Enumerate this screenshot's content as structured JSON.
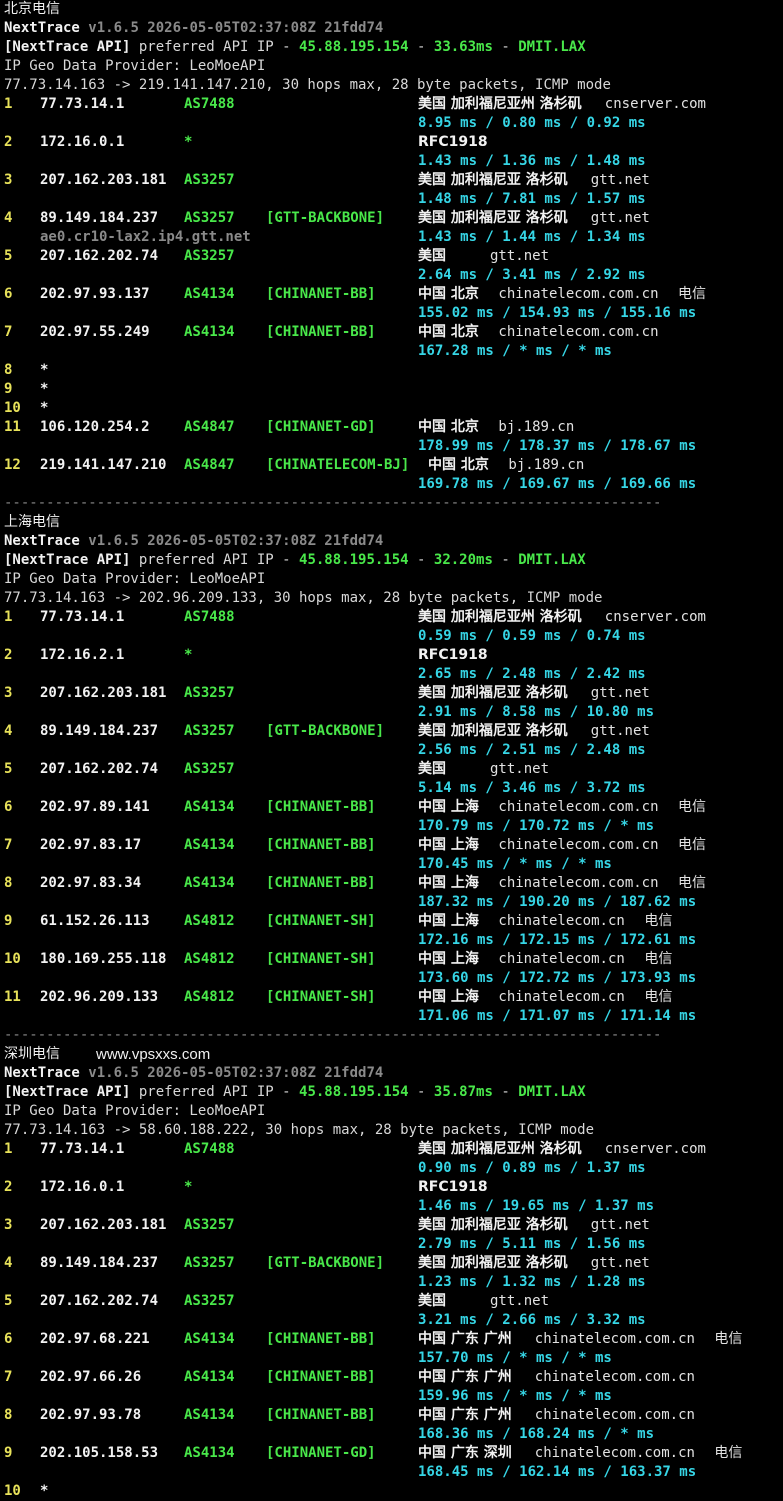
{
  "sections": [
    {
      "title": "北京电信",
      "header": {
        "app": "NextTrace",
        "version": "v1.6.5 2026-05-05T02:37:08Z 21fdd74",
        "api_label": "[NextTrace API]",
        "api_text": " preferred API IP - ",
        "api_ip": "45.88.195.154",
        "api_dash1": " - ",
        "api_latency": "33.63ms",
        "api_dash2": " - ",
        "api_node": "DMIT.LAX",
        "provider": "IP Geo Data Provider: LeoMoeAPI",
        "trace": "77.73.14.163 -> 219.141.147.210, 30 hops max, 28 byte packets, ICMP mode"
      },
      "hops": [
        {
          "n": "1",
          "ip": "77.73.14.1",
          "asn": "AS7488",
          "tag": "",
          "geo": "美国 加利福尼亚州 洛杉矶",
          "host": "cnserver.com",
          "isp": "",
          "rtt": "8.95 ms / 0.80 ms / 0.92 ms"
        },
        {
          "n": "2",
          "ip": "172.16.0.1",
          "asn": "*",
          "tag": "",
          "geo": "RFC1918",
          "host": "",
          "isp": "",
          "rtt": "1.43 ms / 1.36 ms / 1.48 ms"
        },
        {
          "n": "3",
          "ip": "207.162.203.181",
          "asn": "AS3257",
          "tag": "",
          "geo": "美国 加利福尼亚 洛杉矶",
          "host": "gtt.net",
          "isp": "",
          "rtt": "1.48 ms / 7.81 ms / 1.57 ms"
        },
        {
          "n": "4",
          "ip": "89.149.184.237",
          "asn": "AS3257",
          "tag": "[GTT-BACKBONE]",
          "geo": "美国 加利福尼亚 洛杉矶",
          "host": "gtt.net",
          "isp": "",
          "rtt": "1.43 ms / 1.44 ms / 1.34 ms",
          "ptr": "ae0.cr10-lax2.ip4.gtt.net"
        },
        {
          "n": "5",
          "ip": "207.162.202.74",
          "asn": "AS3257",
          "tag": "",
          "geo": "美国",
          "host": "gtt.net",
          "isp": "",
          "rtt": "2.64 ms / 3.41 ms / 2.92 ms"
        },
        {
          "n": "6",
          "ip": "202.97.93.137",
          "asn": "AS4134",
          "tag": "[CHINANET-BB]",
          "geo": "中国 北京",
          "host": "chinatelecom.com.cn",
          "isp": "电信",
          "rtt": "155.02 ms / 154.93 ms / 155.16 ms"
        },
        {
          "n": "7",
          "ip": "202.97.55.249",
          "asn": "AS4134",
          "tag": "[CHINANET-BB]",
          "geo": "中国 北京",
          "host": "chinatelecom.com.cn",
          "isp": "",
          "rtt": "167.28 ms / * ms / * ms"
        },
        {
          "n": "8",
          "ip": "*",
          "star": true
        },
        {
          "n": "9",
          "ip": "*",
          "star": true
        },
        {
          "n": "10",
          "ip": "*",
          "star": true
        },
        {
          "n": "11",
          "ip": "106.120.254.2",
          "asn": "AS4847",
          "tag": "[CHINANET-GD]",
          "geo": "中国 北京",
          "host": "bj.189.cn",
          "isp": "",
          "rtt": "178.99 ms / 178.37 ms / 178.67 ms"
        },
        {
          "n": "12",
          "ip": "219.141.147.210",
          "asn": "AS4847",
          "tag": "[CHINATELECOM-BJ]",
          "geo": "中国 北京",
          "host": "bj.189.cn",
          "isp": "",
          "rtt": "169.78 ms / 169.67 ms / 169.66 ms",
          "geoShift": true
        }
      ]
    },
    {
      "title": "上海电信",
      "header": {
        "app": "NextTrace",
        "version": "v1.6.5 2026-05-05T02:37:08Z 21fdd74",
        "api_label": "[NextTrace API]",
        "api_text": " preferred API IP - ",
        "api_ip": "45.88.195.154",
        "api_dash1": " - ",
        "api_latency": "32.20ms",
        "api_dash2": " - ",
        "api_node": "DMIT.LAX",
        "provider": "IP Geo Data Provider: LeoMoeAPI",
        "trace": "77.73.14.163 -> 202.96.209.133, 30 hops max, 28 byte packets, ICMP mode"
      },
      "hops": [
        {
          "n": "1",
          "ip": "77.73.14.1",
          "asn": "AS7488",
          "tag": "",
          "geo": "美国 加利福尼亚州 洛杉矶",
          "host": "cnserver.com",
          "isp": "",
          "rtt": "0.59 ms / 0.59 ms / 0.74 ms"
        },
        {
          "n": "2",
          "ip": "172.16.2.1",
          "asn": "*",
          "tag": "",
          "geo": "RFC1918",
          "host": "",
          "isp": "",
          "rtt": "2.65 ms / 2.48 ms / 2.42 ms"
        },
        {
          "n": "3",
          "ip": "207.162.203.181",
          "asn": "AS3257",
          "tag": "",
          "geo": "美国 加利福尼亚 洛杉矶",
          "host": "gtt.net",
          "isp": "",
          "rtt": "2.91 ms / 8.58 ms / 10.80 ms"
        },
        {
          "n": "4",
          "ip": "89.149.184.237",
          "asn": "AS3257",
          "tag": "[GTT-BACKBONE]",
          "geo": "美国 加利福尼亚 洛杉矶",
          "host": "gtt.net",
          "isp": "",
          "rtt": "2.56 ms / 2.51 ms / 2.48 ms"
        },
        {
          "n": "5",
          "ip": "207.162.202.74",
          "asn": "AS3257",
          "tag": "",
          "geo": "美国",
          "host": "gtt.net",
          "isp": "",
          "rtt": "5.14 ms / 3.46 ms / 3.72 ms"
        },
        {
          "n": "6",
          "ip": "202.97.89.141",
          "asn": "AS4134",
          "tag": "[CHINANET-BB]",
          "geo": "中国 上海",
          "host": "chinatelecom.com.cn",
          "isp": "电信",
          "rtt": "170.79 ms / 170.72 ms / * ms"
        },
        {
          "n": "7",
          "ip": "202.97.83.17",
          "asn": "AS4134",
          "tag": "[CHINANET-BB]",
          "geo": "中国 上海",
          "host": "chinatelecom.com.cn",
          "isp": "电信",
          "rtt": "170.45 ms / * ms / * ms"
        },
        {
          "n": "8",
          "ip": "202.97.83.34",
          "asn": "AS4134",
          "tag": "[CHINANET-BB]",
          "geo": "中国 上海",
          "host": "chinatelecom.com.cn",
          "isp": "电信",
          "rtt": "187.32 ms / 190.20 ms / 187.62 ms"
        },
        {
          "n": "9",
          "ip": "61.152.26.113",
          "asn": "AS4812",
          "tag": "[CHINANET-SH]",
          "geo": "中国 上海",
          "host": "chinatelecom.cn",
          "isp": "电信",
          "rtt": "172.16 ms / 172.15 ms / 172.61 ms"
        },
        {
          "n": "10",
          "ip": "180.169.255.118",
          "asn": "AS4812",
          "tag": "[CHINANET-SH]",
          "geo": "中国 上海",
          "host": "chinatelecom.cn",
          "isp": "电信",
          "rtt": "173.60 ms / 172.72 ms / 173.93 ms"
        },
        {
          "n": "11",
          "ip": "202.96.209.133",
          "asn": "AS4812",
          "tag": "[CHINANET-SH]",
          "geo": "中国 上海",
          "host": "chinatelecom.cn",
          "isp": "电信",
          "rtt": "171.06 ms / 171.07 ms / 171.14 ms"
        }
      ]
    },
    {
      "title": "深圳电信",
      "watermark": "www.vpsxxs.com",
      "header": {
        "app": "NextTrace",
        "version": "v1.6.5 2026-05-05T02:37:08Z 21fdd74",
        "api_label": "[NextTrace API]",
        "api_text": " preferred API IP - ",
        "api_ip": "45.88.195.154",
        "api_dash1": " - ",
        "api_latency": "35.87ms",
        "api_dash2": " - ",
        "api_node": "DMIT.LAX",
        "provider": "IP Geo Data Provider: LeoMoeAPI",
        "trace": "77.73.14.163 -> 58.60.188.222, 30 hops max, 28 byte packets, ICMP mode"
      },
      "hops": [
        {
          "n": "1",
          "ip": "77.73.14.1",
          "asn": "AS7488",
          "tag": "",
          "geo": "美国 加利福尼亚州 洛杉矶",
          "host": "cnserver.com",
          "isp": "",
          "rtt": "0.90 ms / 0.89 ms / 1.37 ms"
        },
        {
          "n": "2",
          "ip": "172.16.0.1",
          "asn": "*",
          "tag": "",
          "geo": "RFC1918",
          "host": "",
          "isp": "",
          "rtt": "1.46 ms / 19.65 ms / 1.37 ms"
        },
        {
          "n": "3",
          "ip": "207.162.203.181",
          "asn": "AS3257",
          "tag": "",
          "geo": "美国 加利福尼亚 洛杉矶",
          "host": "gtt.net",
          "isp": "",
          "rtt": "2.79 ms / 5.11 ms / 1.56 ms"
        },
        {
          "n": "4",
          "ip": "89.149.184.237",
          "asn": "AS3257",
          "tag": "[GTT-BACKBONE]",
          "geo": "美国 加利福尼亚 洛杉矶",
          "host": "gtt.net",
          "isp": "",
          "rtt": "1.23 ms / 1.32 ms / 1.28 ms"
        },
        {
          "n": "5",
          "ip": "207.162.202.74",
          "asn": "AS3257",
          "tag": "",
          "geo": "美国",
          "host": "gtt.net",
          "isp": "",
          "rtt": "3.21 ms / 2.66 ms / 3.32 ms"
        },
        {
          "n": "6",
          "ip": "202.97.68.221",
          "asn": "AS4134",
          "tag": "[CHINANET-BB]",
          "geo": "中国 广东 广州",
          "host": "chinatelecom.com.cn",
          "isp": "电信",
          "rtt": "157.70 ms / * ms / * ms"
        },
        {
          "n": "7",
          "ip": "202.97.66.26",
          "asn": "AS4134",
          "tag": "[CHINANET-BB]",
          "geo": "中国 广东 广州",
          "host": "chinatelecom.com.cn",
          "isp": "",
          "rtt": "159.96 ms / * ms / * ms"
        },
        {
          "n": "8",
          "ip": "202.97.93.78",
          "asn": "AS4134",
          "tag": "[CHINANET-BB]",
          "geo": "中国 广东 广州",
          "host": "chinatelecom.com.cn",
          "isp": "",
          "rtt": "168.36 ms / 168.24 ms / * ms"
        },
        {
          "n": "9",
          "ip": "202.105.158.53",
          "asn": "AS4134",
          "tag": "[CHINANET-GD]",
          "geo": "中国 广东 深圳",
          "host": "chinatelecom.com.cn",
          "isp": "电信",
          "rtt": "168.45 ms / 162.14 ms / 163.37 ms"
        },
        {
          "n": "10",
          "ip": "*",
          "star": true
        }
      ]
    }
  ],
  "separator": "------------------------------------------------------------------------------"
}
